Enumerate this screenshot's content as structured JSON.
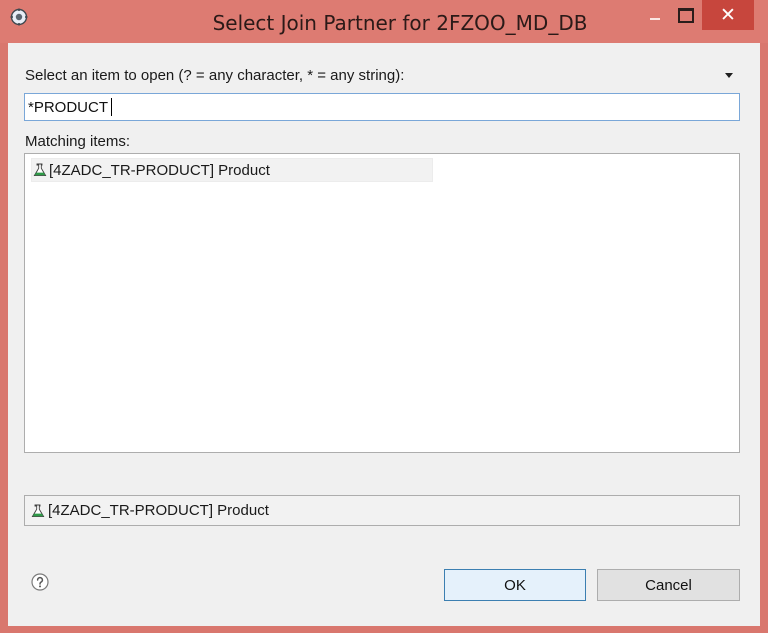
{
  "window": {
    "title": "Select Join Partner for 2FZOO_MD_DB",
    "close_glyph": "✕"
  },
  "dialog": {
    "prompt": "Select an item to open (? = any character, * = any string):",
    "search_value": "*PRODUCT",
    "matching_label": "Matching items:",
    "items": [
      {
        "icon": "flask-icon",
        "label": "[4ZADC_TR-PRODUCT] Product"
      }
    ],
    "detail": {
      "icon": "flask-icon",
      "label": "[4ZADC_TR-PRODUCT] Product"
    }
  },
  "buttons": {
    "ok": "OK",
    "cancel": "Cancel"
  },
  "colors": {
    "titlebar": "#dd7b72",
    "close": "#c7463d",
    "focus_border": "#7aa7d8"
  }
}
